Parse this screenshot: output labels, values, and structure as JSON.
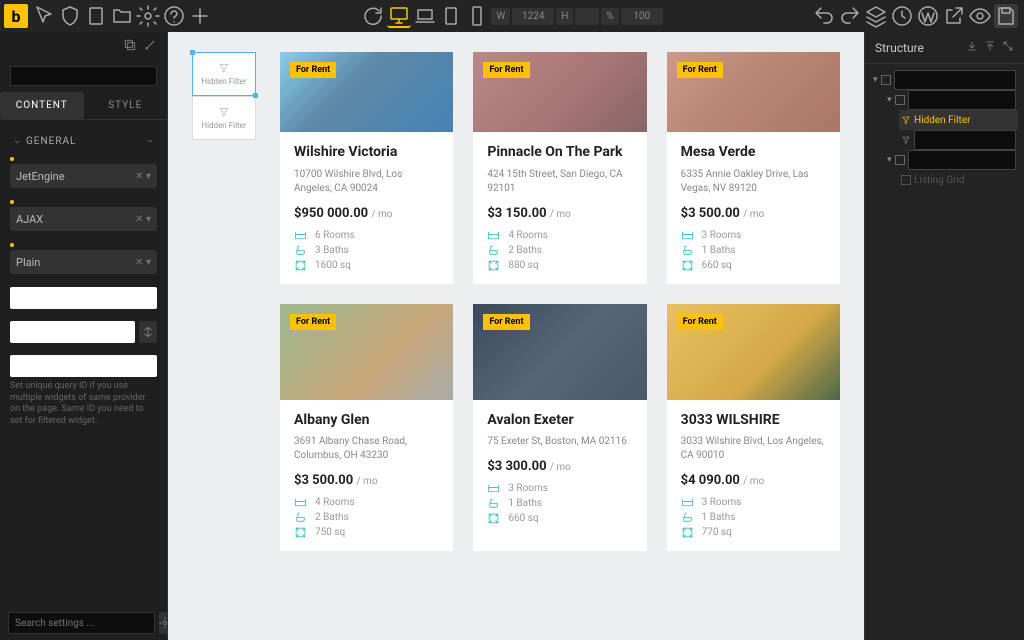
{
  "topbar": {
    "width_label": "W",
    "width_value": "1224",
    "height_label": "H",
    "zoom_label": "%",
    "zoom_value": "100"
  },
  "left": {
    "tabs": {
      "content": "CONTENT",
      "style": "STYLE"
    },
    "general_label": "GENERAL",
    "select1": "JetEngine",
    "select2": "AJAX",
    "select3": "Plain",
    "help": "Set unique query ID if you use multiple widgets of same provider on the page. Same ID you need to set for filtered widget.",
    "bottom_search_placeholder": "Search settings ..."
  },
  "filters": {
    "hidden_filter": "Hidden Filter"
  },
  "listings": [
    {
      "badge": "For Rent",
      "title": "Wilshire Victoria",
      "address": "10700 Wilshire Blvd, Los Angeles, CA 90024",
      "price": "$950 000.00",
      "per": "/ mo",
      "rooms": "6 Rooms",
      "baths": "3 Baths",
      "area": "1600 sq",
      "img": "img-a",
      "tall": false
    },
    {
      "badge": "For Rent",
      "title": "Pinnacle On The Park",
      "address": "424 15th Street, San Diego, CA 92101",
      "price": "$3 150.00",
      "per": "/ mo",
      "rooms": "4 Rooms",
      "baths": "2 Baths",
      "area": "880 sq",
      "img": "img-b",
      "tall": false
    },
    {
      "badge": "For Rent",
      "title": "Mesa Verde",
      "address": "6335 Annie Oakley Drive, Las Vegas, NV 89120",
      "price": "$3 500.00",
      "per": "/ mo",
      "rooms": "3 Rooms",
      "baths": "1 Baths",
      "area": "660 sq",
      "img": "img-c",
      "tall": false
    },
    {
      "badge": "For Rent",
      "title": "Albany Glen",
      "address": "3691 Albany Chase Road, Columbus, OH 43230",
      "price": "$3 500.00",
      "per": "/ mo",
      "rooms": "4 Rooms",
      "baths": "2 Baths",
      "area": "750 sq",
      "img": "img-d",
      "tall": true
    },
    {
      "badge": "For Rent",
      "title": "Avalon Exeter",
      "address": "75 Exeter St, Boston, MA 02116",
      "price": "$3 300.00",
      "per": "/ mo",
      "rooms": "3 Rooms",
      "baths": "1 Baths",
      "area": "660 sq",
      "img": "img-e",
      "tall": true
    },
    {
      "badge": "For Rent",
      "title": "3033 WILSHIRE",
      "address": "3033 Wilshire Blvd, Los Angeles, CA 90010",
      "price": "$4 090.00",
      "per": "/ mo",
      "rooms": "3 Rooms",
      "baths": "1 Baths",
      "area": "770 sq",
      "img": "img-f",
      "tall": true
    }
  ],
  "right": {
    "title": "Structure",
    "item_hidden_filter": "Hidden Filter",
    "item_listing": "Listing Grid"
  }
}
